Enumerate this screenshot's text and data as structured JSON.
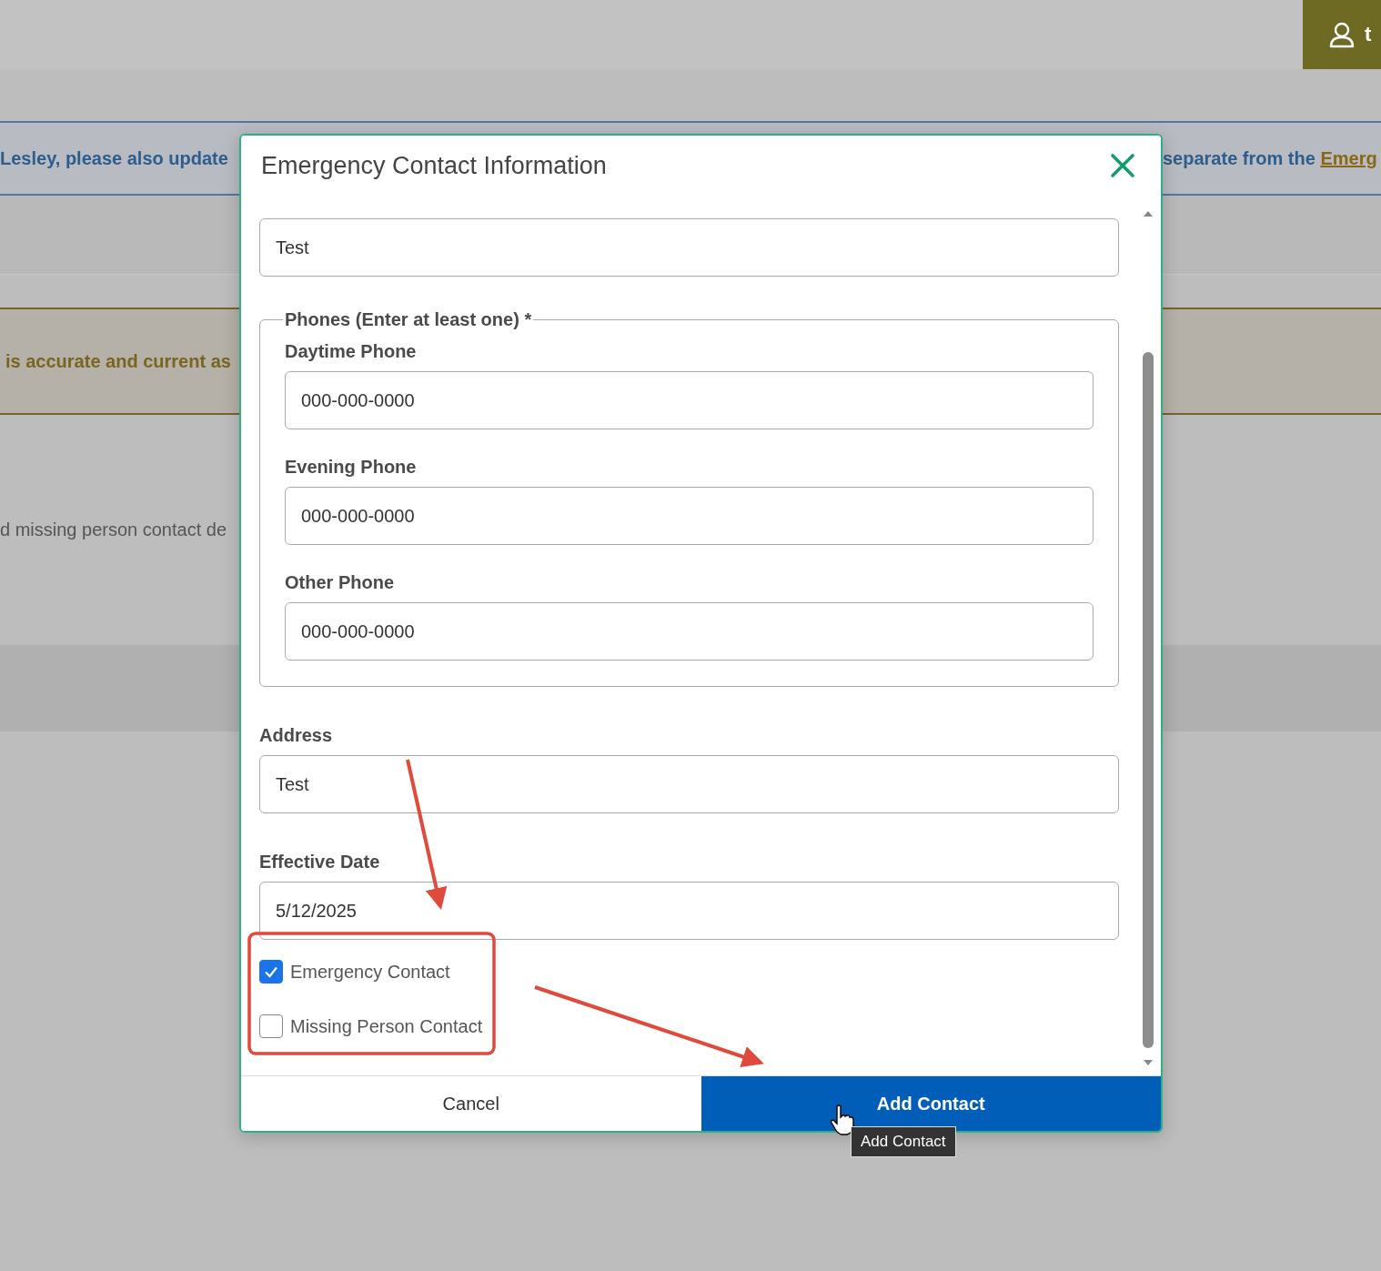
{
  "header": {
    "user_text": "t"
  },
  "notice": {
    "left_text": "Lesley, please also update",
    "right_text": "separate from the ",
    "right_link": "Emerg"
  },
  "alert": {
    "text": "is accurate and current as"
  },
  "intro": {
    "text": "d missing person contact de"
  },
  "dialog": {
    "title": "Emergency Contact Information",
    "fields": [
      {
        "value": "Test"
      }
    ],
    "phones": {
      "legend": "Phones (Enter at least one) *",
      "fields": [
        {
          "label": "Daytime Phone",
          "value": "000-000-0000"
        },
        {
          "label": "Evening Phone",
          "value": "000-000-0000"
        },
        {
          "label": "Other Phone",
          "value": "000-000-0000"
        }
      ]
    },
    "fields_after": [
      {
        "label": "Address",
        "value": "Test"
      },
      {
        "label": "Effective Date",
        "value": "5/12/2025"
      }
    ],
    "checkboxes": [
      {
        "label": "Emergency Contact",
        "checked": true
      },
      {
        "label": "Missing Person Contact",
        "checked": false
      }
    ],
    "buttons": [
      {
        "label": "Cancel",
        "kind": "secondary"
      },
      {
        "label": "Add Contact",
        "kind": "primary"
      }
    ]
  },
  "tooltip": {
    "text": "Add Contact"
  }
}
